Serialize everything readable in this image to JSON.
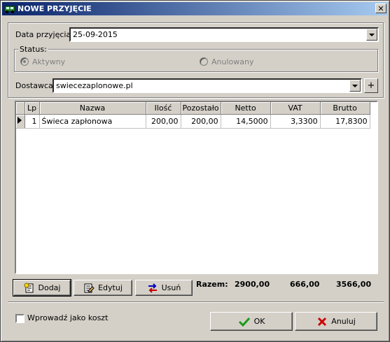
{
  "window": {
    "title": "NOWE PRZYJĘCIE"
  },
  "header": {
    "date_label": "Data przyjęcia:",
    "date_value": "25-09-2015",
    "status_label": "Status:",
    "status_active": "Aktywny",
    "status_cancelled": "Anulowany",
    "supplier_label": "Dostawca:",
    "supplier_value": "swiecezaplonowe.pl",
    "add_supplier": "+"
  },
  "table": {
    "columns": [
      "Lp",
      "Nazwa",
      "Ilość",
      "Pozostało",
      "Netto",
      "VAT",
      "Brutto"
    ],
    "rows": [
      [
        "1",
        "Świeca zapłonowa",
        "200,00",
        "200,00",
        "14,5000",
        "3,3300",
        "17,8300"
      ]
    ]
  },
  "actions": {
    "add": "Dodaj",
    "edit": "Edytuj",
    "delete": "Usuń"
  },
  "totals": {
    "label": "Razem:",
    "netto": "2900,00",
    "vat": "666,00",
    "brutto": "3566,00"
  },
  "footer": {
    "cost_checkbox": "Wprowadź jako koszt",
    "ok": "OK",
    "cancel": "Anuluj"
  },
  "icons": {
    "app": "truck-icon",
    "ok": "checkmark-icon",
    "cancel": "x-icon"
  }
}
